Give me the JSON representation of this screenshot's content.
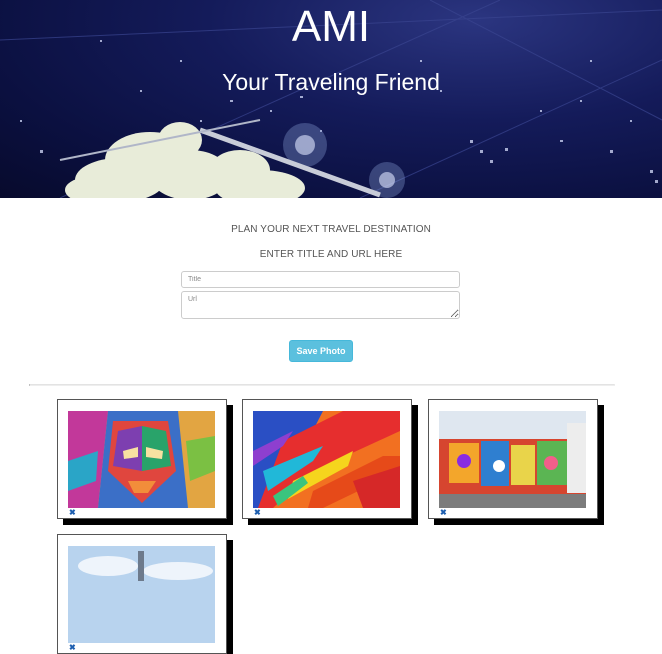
{
  "hero": {
    "title": "AMI",
    "subtitle": "Your Traveling Friend"
  },
  "form": {
    "heading": "PLAN YOUR NEXT TRAVEL DESTINATION",
    "instruction": "ENTER TITLE AND URL HERE",
    "title_placeholder": "Title",
    "url_placeholder": "Url",
    "title_value": "",
    "url_value": "",
    "save_label": "Save Photo"
  },
  "colors": {
    "save_button": "#5bc0de",
    "delete_icon": "#1e5fb0",
    "hero_background": "#0b1040"
  },
  "photos": [
    {
      "description": "colorful geometric face mural",
      "delete_icon": "close-icon",
      "delete_glyph": "✖"
    },
    {
      "description": "abstract rainbow paint strokes",
      "delete_icon": "close-icon",
      "delete_glyph": "✖"
    },
    {
      "description": "graffiti wall mural",
      "delete_icon": "close-icon",
      "delete_glyph": "✖"
    },
    {
      "description": "sky and city photo",
      "delete_icon": "close-icon",
      "delete_glyph": "✖"
    }
  ]
}
